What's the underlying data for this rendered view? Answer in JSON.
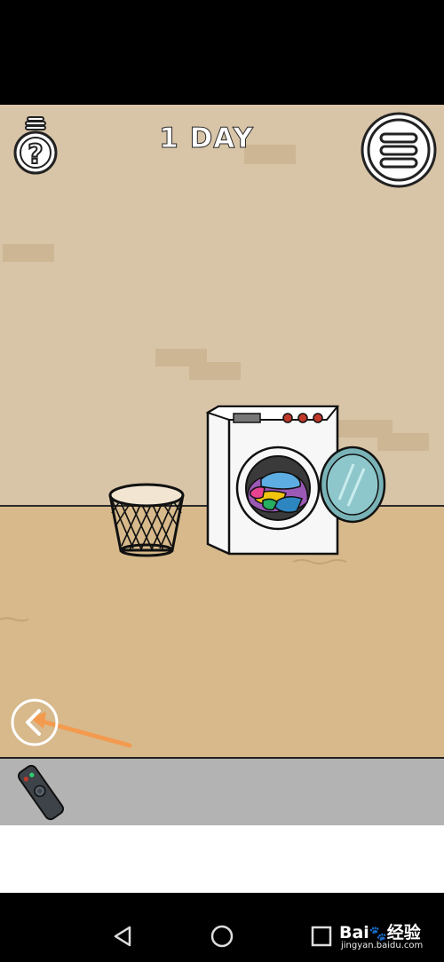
{
  "hud": {
    "day_label": "1 DAY"
  },
  "icons": {
    "hint": "lightbulb-question-icon",
    "menu": "hamburger-menu-icon",
    "back": "chevron-left-icon",
    "inventory_item": "remote-control-icon"
  },
  "watermark": {
    "brand": "Bai",
    "brand_suffix": "经验",
    "url": "jingyan.baidu.com"
  },
  "colors": {
    "wall": "#d8c4a7",
    "floor": "#d7b98b",
    "annotation_arrow": "#f39a4f",
    "inventory_bg": "#b3b3b3"
  }
}
